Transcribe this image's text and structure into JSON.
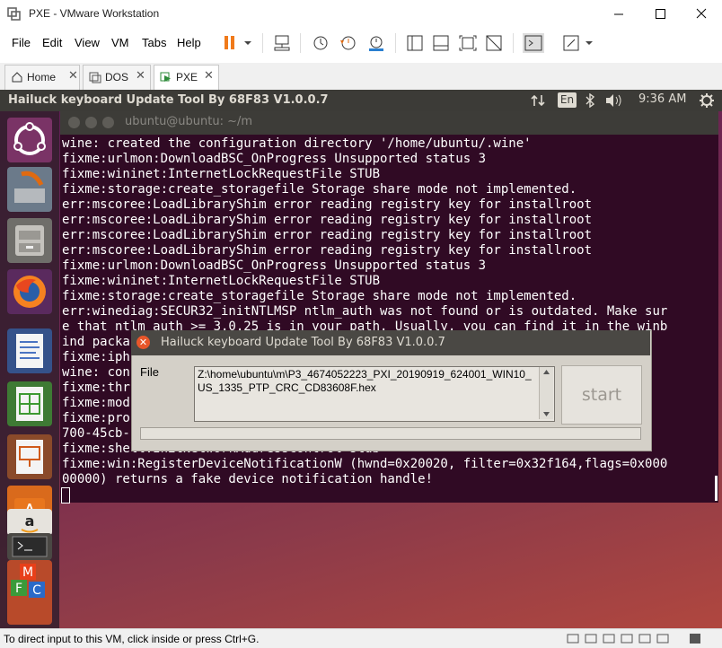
{
  "window": {
    "title": "PXE - VMware Workstation"
  },
  "menu": [
    "File",
    "Edit",
    "View",
    "VM",
    "Tabs",
    "Help"
  ],
  "tabs": [
    {
      "label": "Home"
    },
    {
      "label": "DOS"
    },
    {
      "label": "PXE"
    }
  ],
  "ubuntu_topbar": {
    "app_title": "Hailuck keyboard Update Tool  By 68F83   V1.0.0.7",
    "lang": "En",
    "time": "9:36 AM"
  },
  "terminal": {
    "title": "ubuntu@ubuntu: ~/m",
    "lines": [
      "wine: created the configuration directory '/home/ubuntu/.wine'",
      "fixme:urlmon:DownloadBSC_OnProgress Unsupported status 3",
      "fixme:wininet:InternetLockRequestFile STUB",
      "fixme:storage:create_storagefile Storage share mode not implemented.",
      "err:mscoree:LoadLibraryShim error reading registry key for installroot",
      "err:mscoree:LoadLibraryShim error reading registry key for installroot",
      "err:mscoree:LoadLibraryShim error reading registry key for installroot",
      "err:mscoree:LoadLibraryShim error reading registry key for installroot",
      "fixme:urlmon:DownloadBSC_OnProgress Unsupported status 3",
      "fixme:wininet:InternetLockRequestFile STUB",
      "fixme:storage:create_storagefile Storage share mode not implemented.",
      "err:winediag:SECUR32_initNTLMSP ntlm_auth was not found or is outdated. Make sur",
      "e that ntlm_auth >= 3.0.25 is in your path. Usually, you can find it in the winb",
      "ind packa                                                               ",
      "fixme:iph                                                          stub",
      "wine: con",
      "fixme:thr                                                          8",
      "fixme:mod",
      "fixme:pro                                                          A087A-A",
      "700-45cb-",
      "fixme:shell:InitNetworkAddressControl stub",
      "fixme:win:RegisterDeviceNotificationW (hwnd=0x20020, filter=0x32f164,flags=0x000",
      "00000) returns a fake device notification handle!"
    ]
  },
  "dialog": {
    "title": "Hailuck keyboard Update Tool  By 68F83   V1.0.0.7",
    "file_label": "File",
    "file_path": "Z:\\home\\ubuntu\\m\\P3_4674052223_PXI_20190919_624001_WIN10_US_1335_PTP_CRC_CD83608F.hex",
    "start_label": "start",
    "progress": 0
  },
  "statusbar": {
    "text": "To direct input to this VM, click inside or press Ctrl+G."
  }
}
